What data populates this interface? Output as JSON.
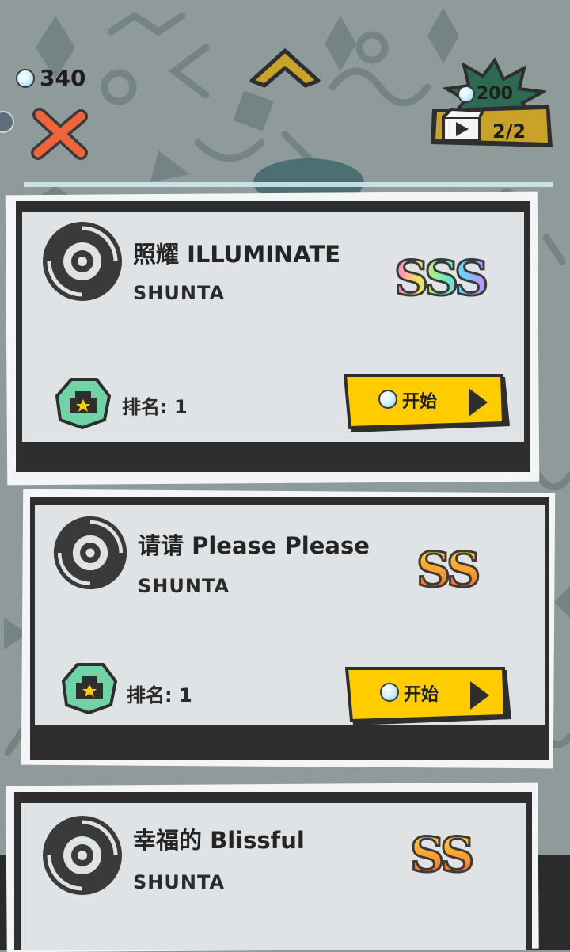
{
  "hud": {
    "gem_count": "340",
    "video_reward_cost": "200",
    "video_reward_remaining": "2/2"
  },
  "songs": [
    {
      "title": "照耀 ILLUMINATE",
      "artist": "SHUNTA",
      "grade": "SSS",
      "rank": "排名: 1",
      "start_label": "开始"
    },
    {
      "title": "请请 Please Please",
      "artist": "SHUNTA",
      "grade": "SS",
      "rank": "排名: 1",
      "start_label": "开始"
    },
    {
      "title": "幸福的 Blissful",
      "artist": "SHUNTA",
      "grade": "SS"
    }
  ],
  "colors": {
    "button_yellow": "#ffcc00",
    "badge_green": "#6fd3a6",
    "close_red": "#f0643a",
    "arrow_gold": "#c9a227"
  },
  "icons": [
    "gem-icon",
    "close-icon",
    "up-arrow-icon",
    "video-icon",
    "play-icon",
    "disc-icon",
    "rank-badge-icon"
  ]
}
